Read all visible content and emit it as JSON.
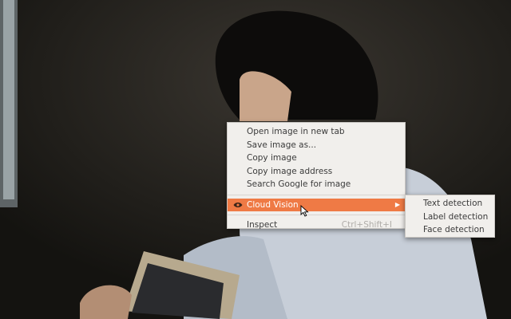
{
  "context_menu": {
    "items": [
      {
        "label": "Open image in new tab"
      },
      {
        "label": "Save image as..."
      },
      {
        "label": "Copy image"
      },
      {
        "label": "Copy image address"
      },
      {
        "label": "Search Google for image"
      }
    ],
    "extension_item": {
      "label": "Cloud Vision",
      "icon": "eye-icon",
      "has_submenu": true
    },
    "inspect": {
      "label": "Inspect",
      "shortcut": "Ctrl+Shift+I"
    }
  },
  "submenu": {
    "items": [
      {
        "label": "Text detection"
      },
      {
        "label": "Label detection"
      },
      {
        "label": "Face detection"
      }
    ]
  },
  "colors": {
    "highlight": "#ef7a45",
    "menu_bg": "#f1efec"
  }
}
